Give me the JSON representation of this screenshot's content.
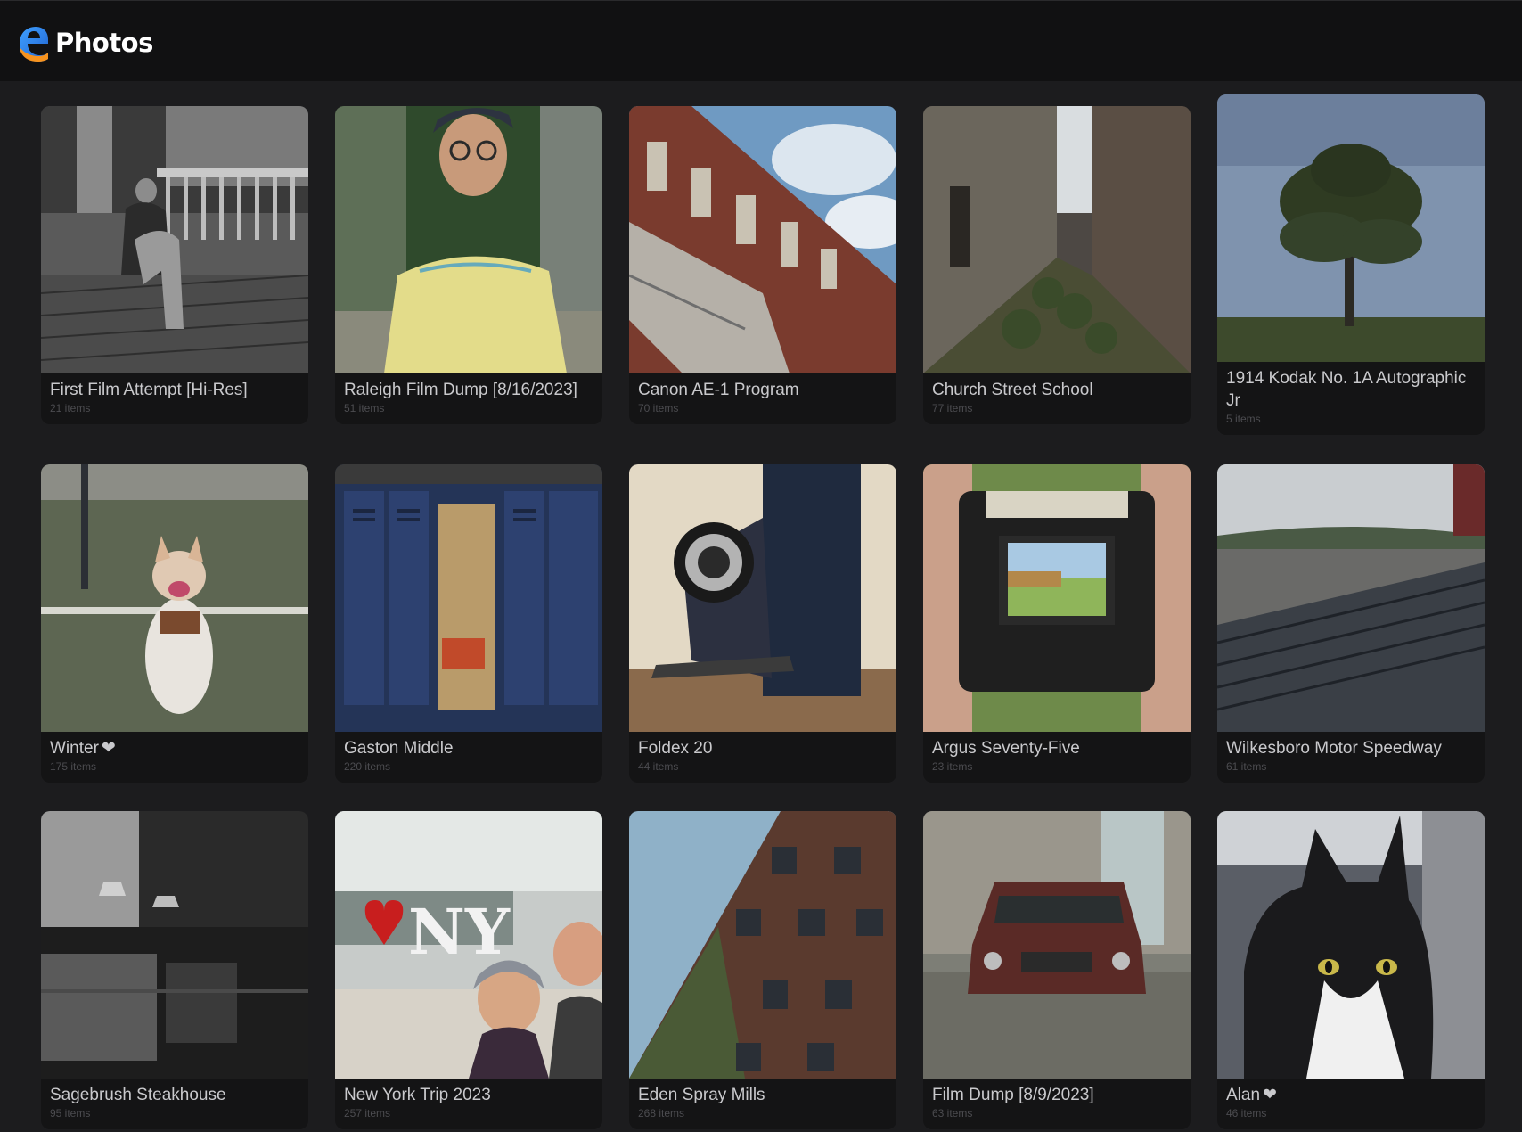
{
  "app": {
    "title": "Photos",
    "logo_icon": "edge-e-logo-icon"
  },
  "albums": [
    {
      "title": "First Film Attempt [Hi-Res]",
      "count": "21 items",
      "favorite": false,
      "thumb": "bw-porch-woman-dog"
    },
    {
      "title": "Raleigh Film Dump [8/16/2023]",
      "count": "51 items",
      "favorite": false,
      "thumb": "man-yellow-shirt"
    },
    {
      "title": "Canon AE-1 Program",
      "count": "70 items",
      "favorite": false,
      "thumb": "brick-factory-sky"
    },
    {
      "title": "Church Street School",
      "count": "77 items",
      "favorite": false,
      "thumb": "abandoned-alley"
    },
    {
      "title": "1914 Kodak No. 1A Autographic Jr",
      "count": "5 items",
      "favorite": false,
      "thumb": "lone-tree"
    },
    {
      "title": "Winter",
      "count": "175 items",
      "favorite": true,
      "thumb": "husky-on-turf"
    },
    {
      "title": "Gaston Middle",
      "count": "220 items",
      "favorite": false,
      "thumb": "blue-lockers"
    },
    {
      "title": "Foldex 20",
      "count": "44 items",
      "favorite": false,
      "thumb": "folding-camera"
    },
    {
      "title": "Argus Seventy-Five",
      "count": "23 items",
      "favorite": false,
      "thumb": "camera-viewfinder"
    },
    {
      "title": "Wilkesboro Motor Speedway",
      "count": "61 items",
      "favorite": false,
      "thumb": "speedway-stands"
    },
    {
      "title": "Sagebrush Steakhouse",
      "count": "95 items",
      "favorite": false,
      "thumb": "dark-restaurant"
    },
    {
      "title": "New York Trip 2023",
      "count": "257 items",
      "favorite": false,
      "thumb": "i-love-ny-selfie"
    },
    {
      "title": "Eden Spray Mills",
      "count": "268 items",
      "favorite": false,
      "thumb": "mill-building"
    },
    {
      "title": "Film Dump [8/9/2023]",
      "count": "63 items",
      "favorite": false,
      "thumb": "rusty-camaro"
    },
    {
      "title": "Alan",
      "count": "46 items",
      "favorite": true,
      "thumb": "tuxedo-cat"
    }
  ],
  "icons": {
    "favorite": "heart-icon"
  },
  "colors": {
    "background": "#1c1c1e",
    "topbar": "#111112",
    "card": "#141415",
    "title_text": "#c9c9cc",
    "count_text": "#4c4c50"
  }
}
